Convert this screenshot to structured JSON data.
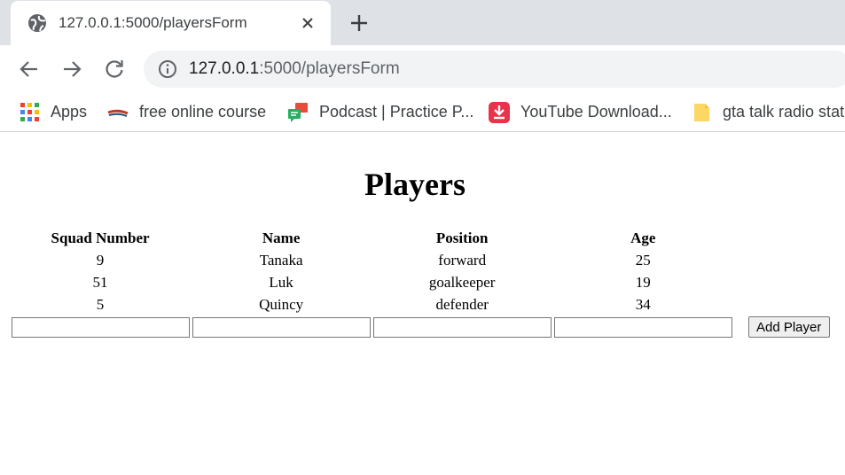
{
  "browser": {
    "tab": {
      "title": "127.0.0.1:5000/playersForm",
      "favicon": "globe-icon"
    },
    "address_bar": {
      "host": "127.0.0.1",
      "path": ":5000/playersForm"
    },
    "bookmarks": [
      {
        "label": "Apps",
        "icon": "apps-grid-icon"
      },
      {
        "label": "free online course",
        "icon": "course-icon"
      },
      {
        "label": "Podcast | Practice P...",
        "icon": "podcast-icon"
      },
      {
        "label": "YouTube Download...",
        "icon": "download-icon"
      },
      {
        "label": "gta talk radio stati",
        "icon": "folder-icon"
      }
    ]
  },
  "page": {
    "title": "Players",
    "table": {
      "headers": [
        "Squad Number",
        "Name",
        "Position",
        "Age"
      ],
      "rows": [
        [
          "9",
          "Tanaka",
          "forward",
          "25"
        ],
        [
          "51",
          "Luk",
          "goalkeeper",
          "19"
        ],
        [
          "5",
          "Quincy",
          "defender",
          "34"
        ]
      ]
    },
    "form": {
      "squad_number": "",
      "name": "",
      "position": "",
      "age": "",
      "submit_label": "Add Player"
    }
  }
}
